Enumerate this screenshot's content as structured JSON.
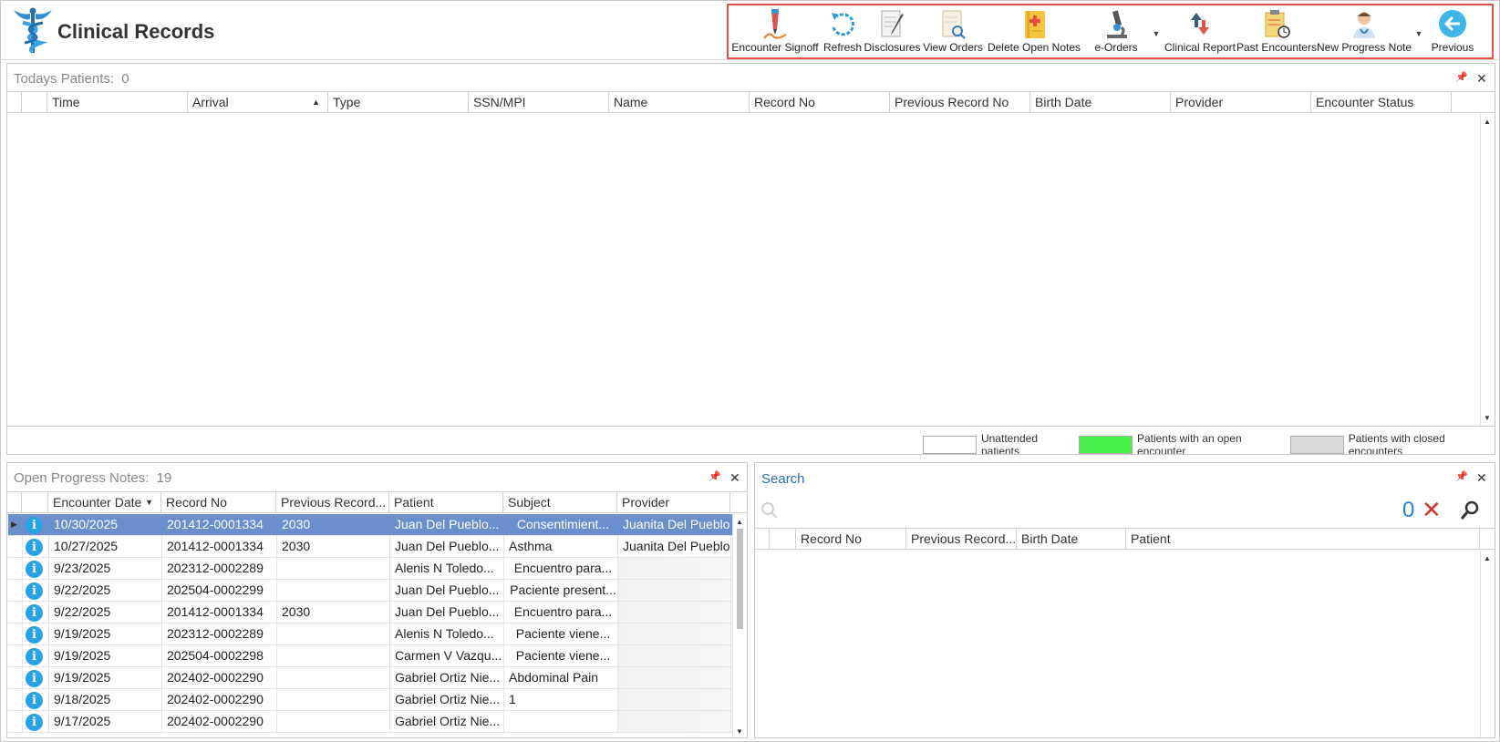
{
  "app": {
    "title": "Clinical Records"
  },
  "toolbar": {
    "buttons": [
      {
        "label": "Encounter Signoff",
        "icon": "pen-signature-icon"
      },
      {
        "label": "Refresh",
        "icon": "refresh-icon"
      },
      {
        "label": "Disclosures",
        "icon": "document-edit-icon"
      },
      {
        "label": "View Orders",
        "icon": "document-search-icon"
      },
      {
        "label": "Delete Open Notes",
        "icon": "medical-notes-icon"
      },
      {
        "label": "e-Orders",
        "icon": "microscope-icon"
      },
      {
        "label": "Clinical Report",
        "icon": "upload-download-icon"
      },
      {
        "label": "Past Encounters",
        "icon": "clipboard-clock-icon"
      },
      {
        "label": "New Progress Note",
        "icon": "doctor-icon"
      },
      {
        "label": "Previous",
        "icon": "back-arrow-icon"
      }
    ]
  },
  "todays": {
    "title": "Todays Patients:",
    "count": "0",
    "columns": [
      "Time",
      "Arrival",
      "Type",
      "SSN/MPI",
      "Name",
      "Record No",
      "Previous Record No",
      "Birth Date",
      "Provider",
      "Encounter Status"
    ],
    "legend": {
      "unattended": "Unattended patients",
      "open": "Patients with an open encounter",
      "closed": "Patients with closed encounters",
      "colors": {
        "unattended": "#ffffff",
        "open": "#4bef4b",
        "closed": "#dcdcdc"
      }
    }
  },
  "notes": {
    "title": "Open Progress Notes:",
    "count": "19",
    "columns": [
      "Encounter Date",
      "Record No",
      "Previous Record...",
      "Patient",
      "Subject",
      "Provider"
    ],
    "rows": [
      {
        "date": "10/30/2025",
        "record": "201412-0001334",
        "prev": "2030",
        "patient": "Juan Del Pueblo...",
        "subject": "Consentimient...",
        "provider": "Juanita Del Pueblo"
      },
      {
        "date": "10/27/2025",
        "record": "201412-0001334",
        "prev": "2030",
        "patient": "Juan Del Pueblo...",
        "subject": "Asthma",
        "provider": "Juanita Del Pueblo"
      },
      {
        "date": "9/23/2025",
        "record": "202312-0002289",
        "prev": "",
        "patient": "Alenis N Toledo...",
        "subject": "Encuentro para...",
        "provider": ""
      },
      {
        "date": "9/22/2025",
        "record": "202504-0002299",
        "prev": "",
        "patient": "Juan Del Pueblo...",
        "subject": "Paciente present...",
        "provider": ""
      },
      {
        "date": "9/22/2025",
        "record": "201412-0001334",
        "prev": "2030",
        "patient": "Juan Del Pueblo...",
        "subject": "Encuentro para...",
        "provider": ""
      },
      {
        "date": "9/19/2025",
        "record": "202312-0002289",
        "prev": "",
        "patient": "Alenis N Toledo...",
        "subject": "Paciente viene...",
        "provider": ""
      },
      {
        "date": "9/19/2025",
        "record": "202504-0002298",
        "prev": "",
        "patient": "Carmen V Vazqu...",
        "subject": "Paciente viene...",
        "provider": ""
      },
      {
        "date": "9/19/2025",
        "record": "202402-0002290",
        "prev": "",
        "patient": "Gabriel Ortiz Nie...",
        "subject": "Abdominal Pain",
        "provider": ""
      },
      {
        "date": "9/18/2025",
        "record": "202402-0002290",
        "prev": "",
        "patient": "Gabriel Ortiz Nie...",
        "subject": "1",
        "provider": ""
      },
      {
        "date": "9/17/2025",
        "record": "202402-0002290",
        "prev": "",
        "patient": "Gabriel Ortiz Nie...",
        "subject": "",
        "provider": ""
      }
    ]
  },
  "search": {
    "title": "Search",
    "result_count": "0",
    "columns": [
      "Record No",
      "Previous Record...",
      "Birth Date",
      "Patient"
    ]
  }
}
